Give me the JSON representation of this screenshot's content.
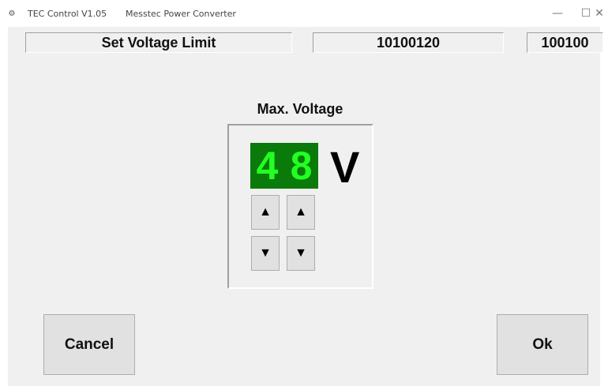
{
  "window": {
    "app_icon": "app-logo-icon",
    "app_title": "TEC Control V1.05",
    "subtitle": "Messtec Power Converter",
    "minimize_glyph": "—",
    "maximize_glyph": "☐",
    "close_glyph": "✕"
  },
  "header": {
    "title": "Set Voltage Limit",
    "code": "10100120",
    "id": "100100"
  },
  "setting": {
    "label": "Max. Voltage",
    "digits": [
      "4",
      "8"
    ],
    "unit": "V",
    "up_glyph": "▲",
    "down_glyph": "▼"
  },
  "buttons": {
    "cancel": "Cancel",
    "ok": "Ok"
  },
  "colors": {
    "display_background": "#0a7a0a",
    "display_digits": "#22ff22"
  }
}
